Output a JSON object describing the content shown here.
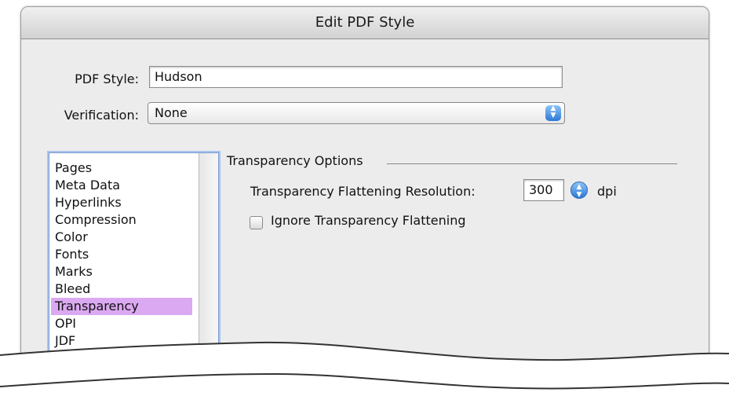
{
  "window": {
    "title": "Edit PDF Style"
  },
  "pdf_style": {
    "label": "PDF Style:",
    "value": "Hudson"
  },
  "verification": {
    "label": "Verification:",
    "value": "None"
  },
  "sidebar": {
    "items": [
      {
        "label": "Pages",
        "selected": false
      },
      {
        "label": "Meta Data",
        "selected": false
      },
      {
        "label": "Hyperlinks",
        "selected": false
      },
      {
        "label": "Compression",
        "selected": false
      },
      {
        "label": "Color",
        "selected": false
      },
      {
        "label": "Fonts",
        "selected": false
      },
      {
        "label": "Marks",
        "selected": false
      },
      {
        "label": "Bleed",
        "selected": false
      },
      {
        "label": "Transparency",
        "selected": true
      },
      {
        "label": "OPI",
        "selected": false
      },
      {
        "label": "JDF",
        "selected": false
      }
    ],
    "selected_color": "#dba9f1"
  },
  "transparency": {
    "group_title": "Transparency Options",
    "resolution_label": "Transparency Flattening Resolution:",
    "resolution_value": "300",
    "unit": "dpi",
    "ignore_label": "Ignore Transparency Flattening",
    "ignore_checked": false
  },
  "colors": {
    "accent": "#2c78d6",
    "dialog_bg": "#ececec"
  }
}
